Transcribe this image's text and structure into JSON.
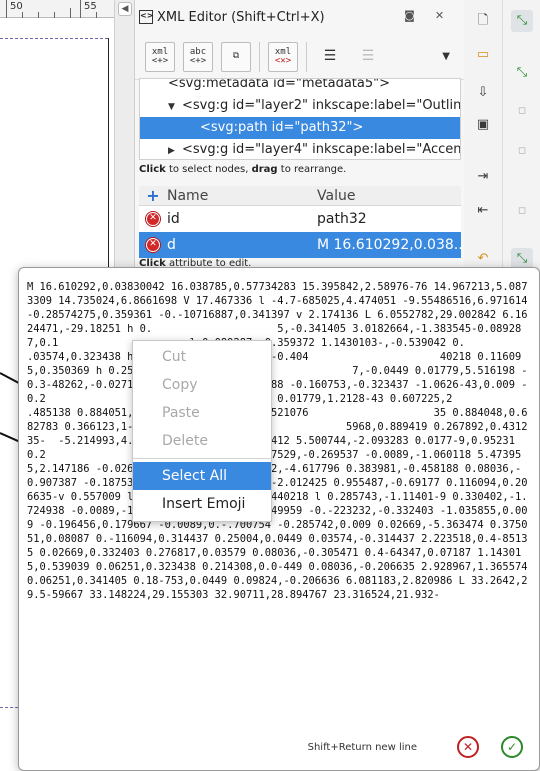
{
  "ruler": {
    "labels": [
      "50",
      "55"
    ]
  },
  "panel": {
    "title": "XML Editor (Shift+Ctrl+X)",
    "toolbar": {
      "new_element": "xml",
      "new_text": "abc",
      "duplicate": "",
      "delete": "xml",
      "indent": "",
      "unindent": ""
    },
    "tree": {
      "rows": [
        {
          "text": "<svg:metadata id=\"metadata5\">"
        },
        {
          "text": "<svg:g id=\"layer2\" inkscape:label=\"Outline"
        },
        {
          "text": "<svg:path id=\"path32\">"
        },
        {
          "text": "<svg:g id=\"layer4\" inkscape:label=\"Accent"
        }
      ]
    },
    "hint_nodes": {
      "bold1": "Click",
      "mid": " to select nodes, ",
      "bold2": "drag",
      "end": " to rearrange."
    },
    "attributes": {
      "header_name": "Name",
      "header_value": "Value",
      "rows": [
        {
          "name": "id",
          "value": "path32"
        },
        {
          "name": "d",
          "value": "M 16.610292,0.038..."
        }
      ]
    },
    "hint_attr": {
      "bold": "Click",
      "end": " attribute to edit."
    }
  },
  "editor": {
    "value": "M 16.610292,0.03830042 16.038785,0.57734283 15.395842,2.58976-76 14.967213,5.0873309 14.735024,6.8661698 V 17.467336 l -4.7-685025,4.474051 -9.55486516,6.971614 -0.28574275,0.359361 -0.-10716887,0.341397 v 2.174136 L 6.0552782,29.002842 6.1624471,-29.18251 h 0.                    5,-0.341405 3.0182664,-1.383545-0.089287,0.1                     l 0.089287,-0.359372 1.1430103-,-0.539042 0.                     .03574,0.323438 h 0.232189 l 0.-116094,-0.404                     40218 0.116095,0.350369 h 0.250-04 l 0.05358,                    7,-0.0449 0.01779,5.516198 -0.3-48262,-0.0271                     788 -0.160753,-0.323437 -1.0626-43,0.009 -0.2                    .125021,1.554236 0.01779,1.2128-43 0.607225,2                     .485138 0.884051,-0.03579 -0.02-668,-0.521076                    35 0.884048,0.682783 0.366123,1-.976492 -0.16                     5968,0.889419 0.267892,0.431235-  -5.214993,4.                    21412 5.500744,-2.093283 0.0177-9,0.95231 0.2                     0.223233 l 0.187529,-0.269537 -0.0089,-1.060118 5.473955,2.147186 -0.02669,-2.021408 -5.21499-2,-4.617796 0.383981,-0.458188 0.08036,-0.907387 -0.187531,-0.-449201 0.401841,-2.012425 0.955487,-0.69177 0.116094,0.206635-v 0.557009 l 0.866188,-0.009 v -0.440218 l 0.285743,-1.11401-9 0.330402,-1.724938 -0.0089,-1.266747 -0.116095,-1.149959 -0.-223232,-0.332403 -1.035855,0.009 -0.196456,0.179667 -0.0089,0.-.700754 -0.285742,0.009 0.02669,-5.363474 0.375051,0.08087 0.-116094,0.314437 0.25004,0.0449 0.03574,-0.314437 2.223518,0.4-85135 0.02669,0.332403 0.276817,0.03579 0.08036,-0.305471 0.4-64347,0.07187 1.143015,0.539039 0.06251,0.323438 0.214308,0.0-449 0.08036,-0.206635 2.928967,1.365574 0.06251,0.341405 0.18-753,0.0449 0.09824,-0.206636 6.081183,2.820986 L 33.2642,29.5-59667 33.148224,29.155303 32.90711,28.894767 23.316524,21.932-",
    "footer_hint": "Shift+Return new line"
  },
  "context_menu": {
    "items": [
      {
        "label": "Cut"
      },
      {
        "label": "Copy"
      },
      {
        "label": "Paste"
      },
      {
        "label": "Delete"
      },
      {
        "label": "Select All"
      },
      {
        "label": "Insert Emoji"
      }
    ]
  },
  "colors": {
    "selection": "#3a89e0",
    "delete_red": "#d42828",
    "ok_green": "#2a8a2a"
  }
}
